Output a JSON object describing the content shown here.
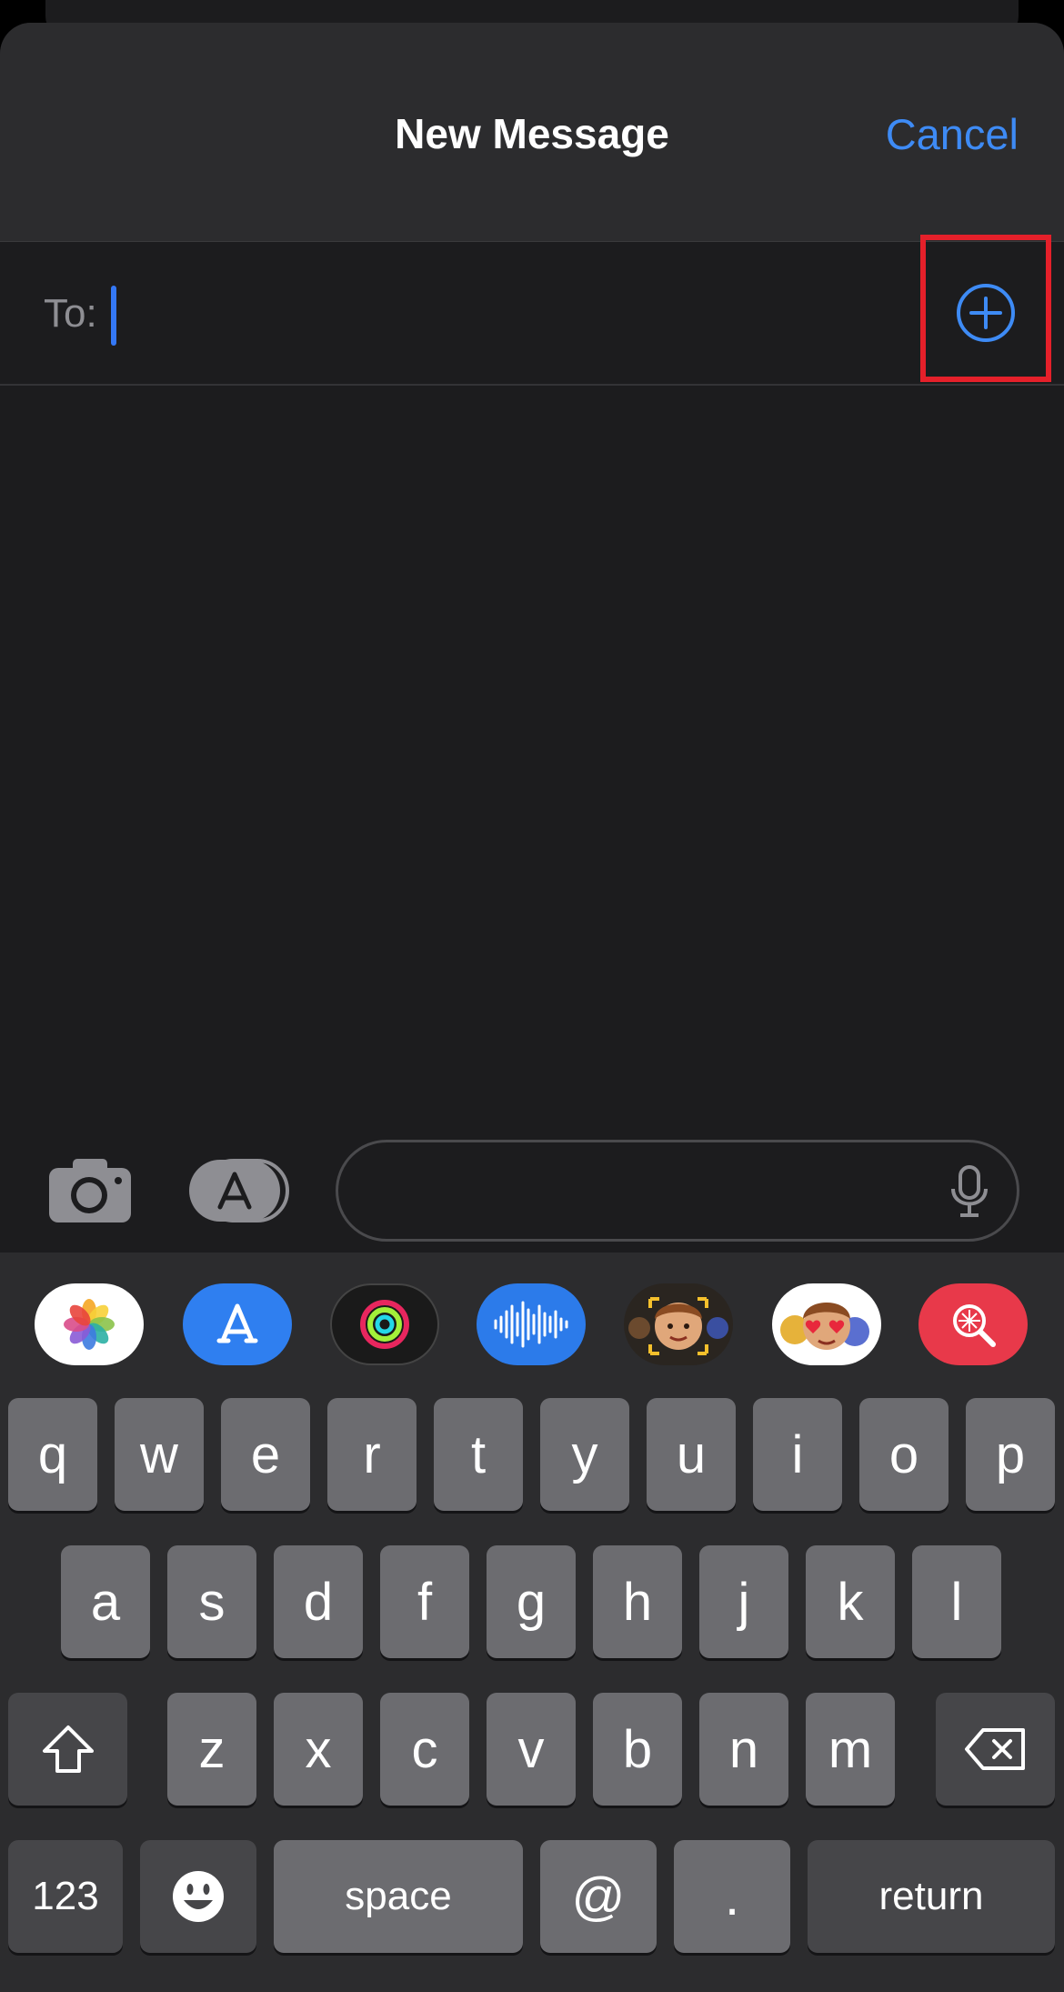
{
  "header": {
    "title": "New Message",
    "cancel_label": "Cancel"
  },
  "recipient": {
    "label": "To:",
    "value": ""
  },
  "compose": {
    "placeholder": ""
  },
  "app_drawer": [
    {
      "name": "photos-app-icon"
    },
    {
      "name": "app-store-icon"
    },
    {
      "name": "activity-app-icon"
    },
    {
      "name": "audio-message-app-icon"
    },
    {
      "name": "memoji-app-icon"
    },
    {
      "name": "memoji-stickers-icon"
    },
    {
      "name": "image-search-app-icon"
    }
  ],
  "keyboard": {
    "row1": [
      "q",
      "w",
      "e",
      "r",
      "t",
      "y",
      "u",
      "i",
      "o",
      "p"
    ],
    "row2": [
      "a",
      "s",
      "d",
      "f",
      "g",
      "h",
      "j",
      "k",
      "l"
    ],
    "row3": [
      "z",
      "x",
      "c",
      "v",
      "b",
      "n",
      "m"
    ],
    "numbers_label": "123",
    "space_label": "space",
    "at_label": "@",
    "period_label": ".",
    "return_label": "return"
  },
  "colors": {
    "accent": "#3e8bf5",
    "highlight_box": "#e5202a",
    "background": "#1c1c1e"
  }
}
